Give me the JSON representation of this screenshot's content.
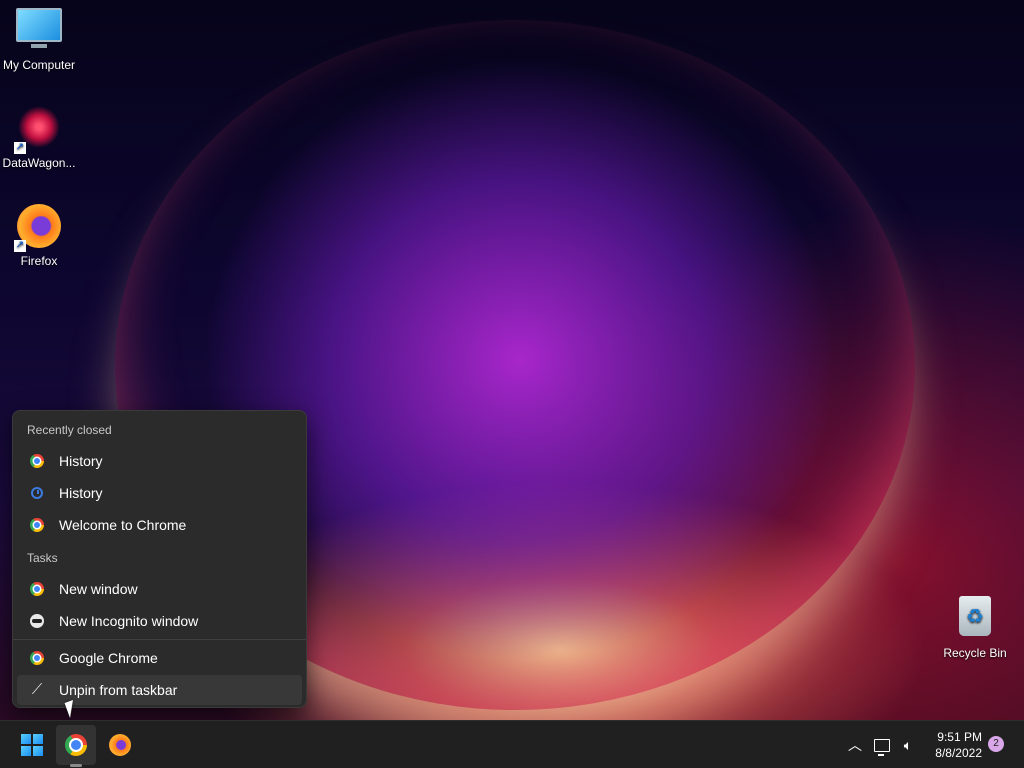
{
  "desktop": {
    "icons": [
      {
        "label": "My Computer",
        "icon": "monitor-icon"
      },
      {
        "label": "DataWagon...",
        "icon": "datawagon-icon"
      },
      {
        "label": "Firefox",
        "icon": "firefox-icon"
      },
      {
        "label": "Recycle Bin",
        "icon": "recycle-bin-icon"
      }
    ]
  },
  "jumplist": {
    "recently_closed_header": "Recently closed",
    "recently_closed": [
      {
        "label": "History",
        "icon": "chrome-icon"
      },
      {
        "label": "History",
        "icon": "history-icon"
      },
      {
        "label": "Welcome to Chrome",
        "icon": "chrome-icon"
      }
    ],
    "tasks_header": "Tasks",
    "tasks": [
      {
        "label": "New window",
        "icon": "chrome-icon"
      },
      {
        "label": "New Incognito window",
        "icon": "incognito-icon"
      }
    ],
    "app": {
      "label": "Google Chrome",
      "icon": "chrome-icon"
    },
    "unpin": {
      "label": "Unpin from taskbar",
      "icon": "unpin-icon"
    }
  },
  "taskbar": {
    "apps": [
      "start-icon",
      "chrome-icon",
      "firefox-icon"
    ],
    "tray": {
      "time": "9:51 PM",
      "date": "8/8/2022",
      "notifications": "2"
    }
  },
  "colors": {
    "taskbar_bg": "#202020",
    "menu_bg": "#2b2b2b",
    "accent": "#1a8cf0"
  }
}
